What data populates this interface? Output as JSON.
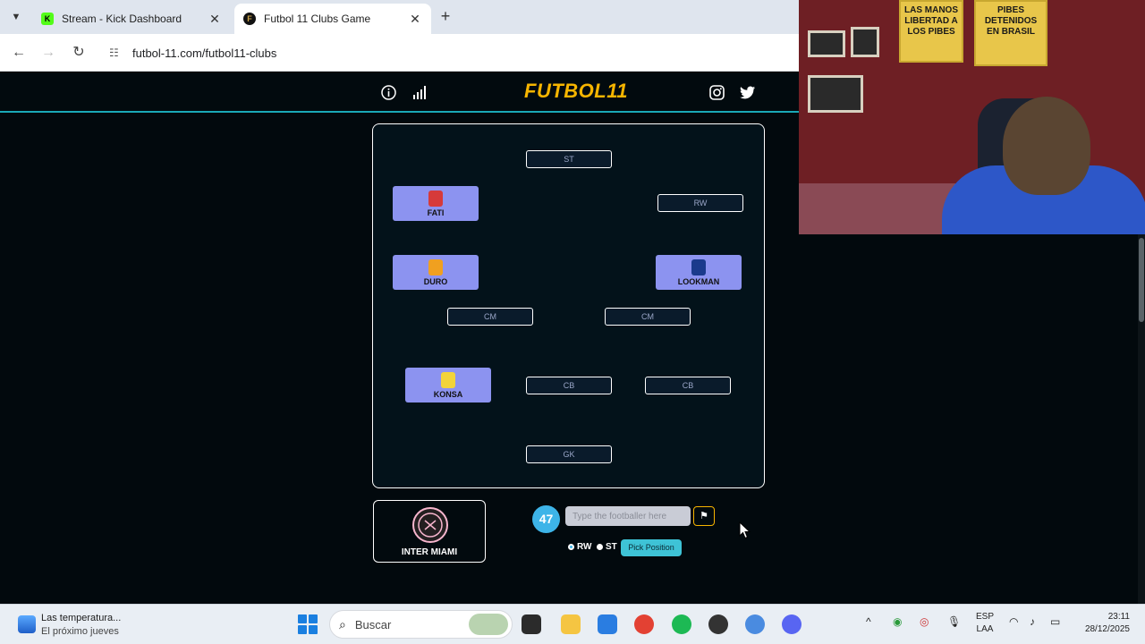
{
  "browser": {
    "tabs": [
      {
        "title": "Stream - Kick Dashboard",
        "favicon": "kick-logo"
      },
      {
        "title": "Futbol 11 Clubs Game",
        "favicon": "futbol11-logo",
        "active": true
      }
    ],
    "url": "futbol-11.com/futbol11-clubs"
  },
  "site": {
    "logo_part1": "FUTBOL",
    "logo_part2": "11",
    "positions": {
      "st": "ST",
      "rw": "RW",
      "cm_left": "CM",
      "cm_right": "CM",
      "cb_center": "CB",
      "cb_right": "CB",
      "gk": "GK"
    },
    "players": [
      {
        "name": "FATI",
        "slot": "LW",
        "crest_color": "#d63a3a"
      },
      {
        "name": "DURO",
        "slot": "LM",
        "crest_color": "#f0a020"
      },
      {
        "name": "LOOKMAN",
        "slot": "RM",
        "crest_color": "#1a3a8c"
      },
      {
        "name": "KONSA",
        "slot": "LB",
        "crest_color": "#f2d43a"
      }
    ],
    "club": {
      "name": "INTER MIAMI",
      "crest_color": "#f7b5cd"
    },
    "score": "47",
    "input_placeholder": "Type the footballer here",
    "radio_options": [
      {
        "label": "RW",
        "selected": true
      },
      {
        "label": "ST",
        "selected": false
      }
    ],
    "pick_button": "Pick Position"
  },
  "webcam": {
    "poster_left": "LAS MANOS LIBERTAD A LOS PIBES",
    "poster_right": "PIBES DETENIDOS EN BRASIL"
  },
  "taskbar": {
    "weather_line1": "Las temperatura...",
    "weather_line2": "El próximo jueves",
    "search_label": "Buscar",
    "lang_line1": "ESP",
    "lang_line2": "LAA",
    "time": "23:11",
    "date": "28/12/2025"
  }
}
